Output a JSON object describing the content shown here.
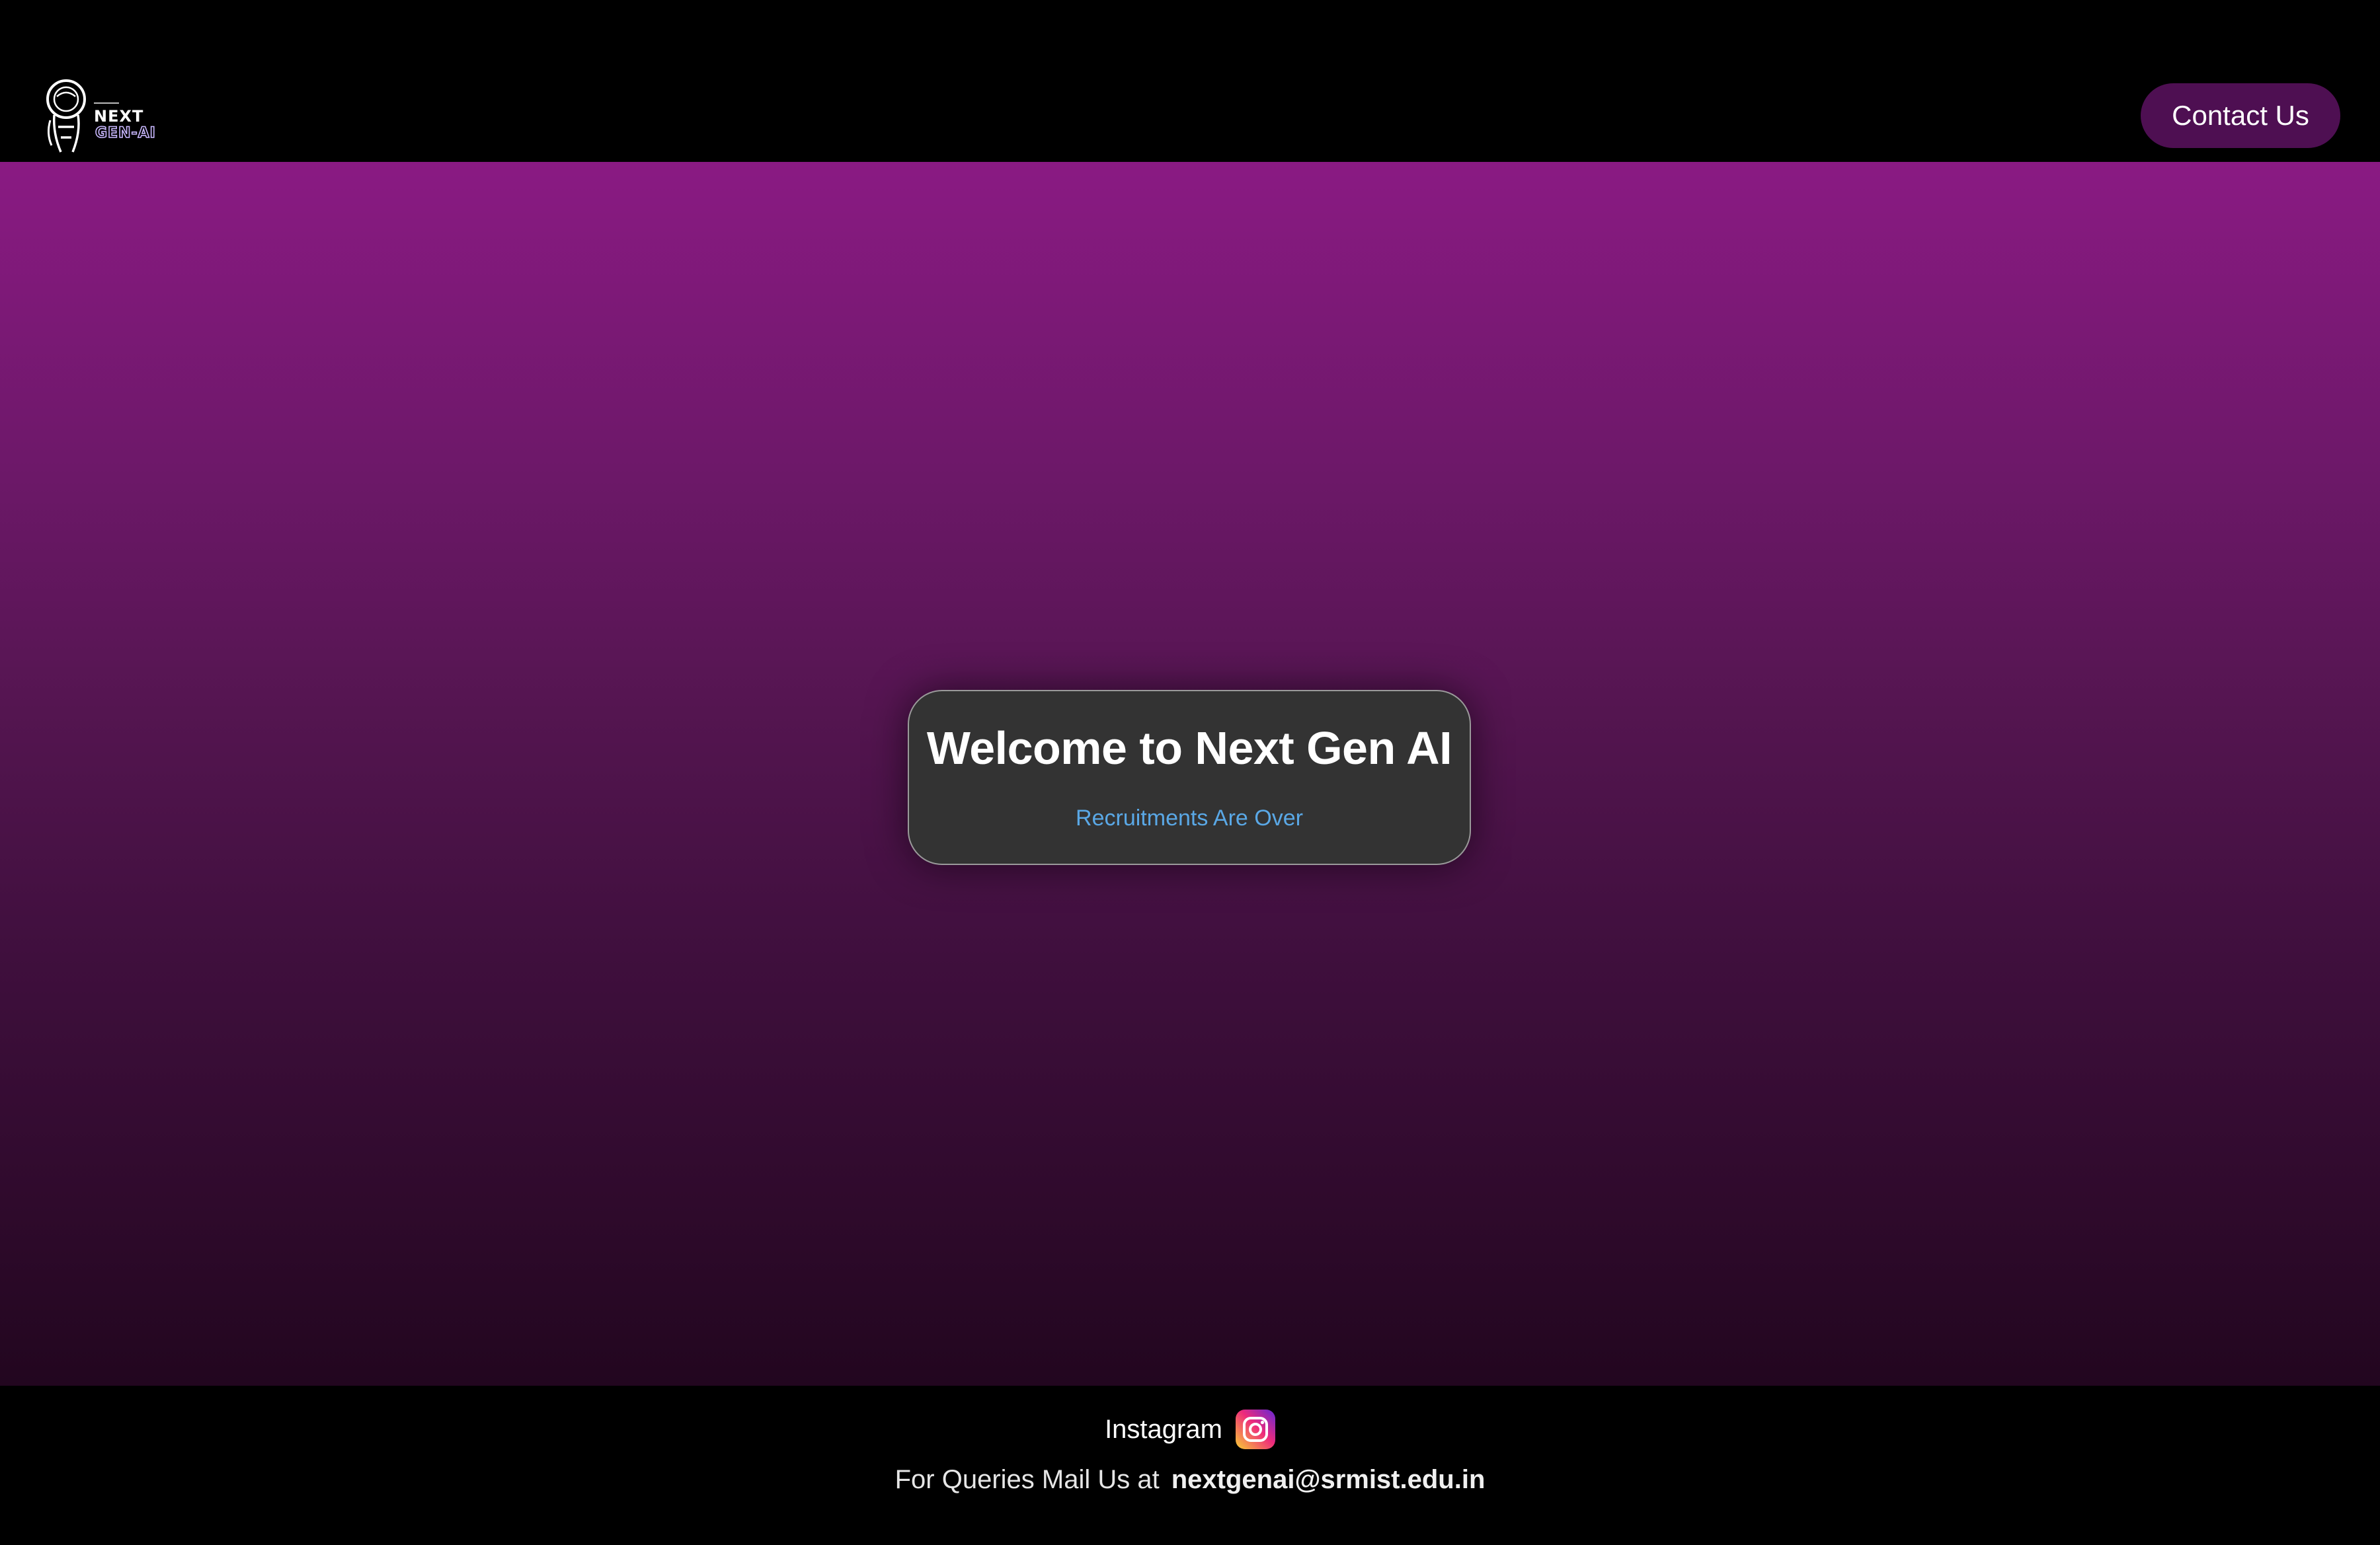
{
  "header": {
    "logo_alt": "Next Gen AI",
    "contact_label": "Contact Us"
  },
  "hero": {
    "title": "Welcome to Next Gen AI",
    "subtitle": "Recruitments Are Over"
  },
  "footer": {
    "instagram_label": "Instagram",
    "mail_text": "For Queries Mail Us at",
    "mail_address": "nextgenai@srmist.edu.in"
  },
  "colors": {
    "accent": "#4e0f52",
    "subtitle": "#5aa8e6",
    "card": "#333333"
  },
  "icons": [
    "astronaut-logo-icon",
    "instagram-icon"
  ]
}
